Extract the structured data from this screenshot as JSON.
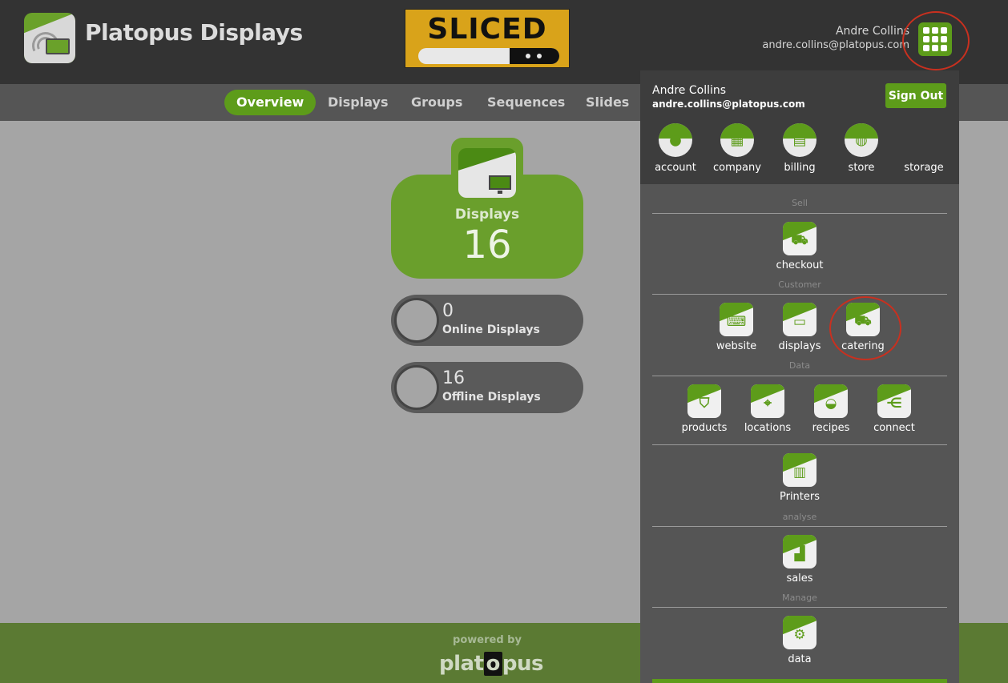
{
  "header": {
    "brand": "Platopus Displays",
    "client_logo_text": "SLICED",
    "user_name": "Andre Collins",
    "user_email": "andre.collins@platopus.com"
  },
  "nav": {
    "items": [
      {
        "label": "Overview",
        "active": true
      },
      {
        "label": "Displays",
        "active": false
      },
      {
        "label": "Groups",
        "active": false
      },
      {
        "label": "Sequences",
        "active": false
      },
      {
        "label": "Slides",
        "active": false
      }
    ]
  },
  "main": {
    "displays_label": "Displays",
    "displays_count": "16",
    "online_count": "0",
    "online_label": "Online Displays",
    "offline_count": "16",
    "offline_label": "Offline Displays"
  },
  "footer": {
    "powered_by": "powered by",
    "brand_pre": "plat",
    "brand_o": "o",
    "brand_post": "pus"
  },
  "panel": {
    "user_name": "Andre Collins",
    "user_email": "andre.collins@platopus.com",
    "sign_out": "Sign Out",
    "top_apps": [
      "account",
      "company",
      "billing",
      "store",
      "storage"
    ],
    "sections": {
      "sell": {
        "title": "Sell",
        "apps": [
          "checkout"
        ]
      },
      "customer": {
        "title": "Customer",
        "apps": [
          "website",
          "displays",
          "catering"
        ]
      },
      "data": {
        "title": "Data",
        "apps": [
          "products",
          "locations",
          "recipes",
          "connect"
        ]
      },
      "printers": {
        "apps": [
          "Printers"
        ]
      },
      "analyse": {
        "title": "analyse",
        "apps": [
          "sales"
        ]
      },
      "manage": {
        "title": "Manage",
        "apps": [
          "data"
        ]
      }
    }
  },
  "colors": {
    "accent": "#5d9c1a",
    "header_bg": "#333333",
    "nav_bg": "#555555",
    "content_bg": "#a5a5a5",
    "footer_bg": "#5b7a33",
    "highlight_ring": "#c9301f"
  }
}
